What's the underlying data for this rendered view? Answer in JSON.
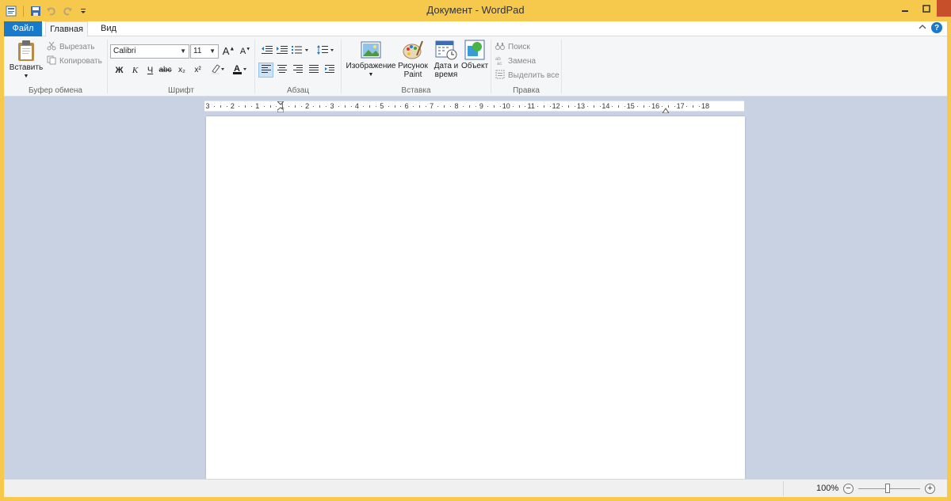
{
  "window": {
    "title": "Документ - WordPad"
  },
  "tabs": {
    "file": "Файл",
    "home": "Главная",
    "view": "Вид"
  },
  "ribbon": {
    "clipboard": {
      "label": "Буфер обмена",
      "paste": "Вставить",
      "cut": "Вырезать",
      "copy": "Копировать"
    },
    "font": {
      "label": "Шрифт",
      "family": "Calibri",
      "size": "11",
      "bold": "Ж",
      "italic": "К",
      "underline": "Ч",
      "strike": "abc",
      "subscript": "x₂",
      "superscript": "x²"
    },
    "paragraph": {
      "label": "Абзац"
    },
    "insert": {
      "label": "Вставка",
      "picture": "Изображение",
      "paint_line1": "Рисунок",
      "paint_line2": "Paint",
      "datetime_line1": "Дата и",
      "datetime_line2": "время",
      "object": "Объект"
    },
    "editing": {
      "label": "Правка",
      "find": "Поиск",
      "replace": "Замена",
      "select_all": "Выделить все"
    }
  },
  "ruler": {
    "ticks": [
      "3",
      "2",
      "1",
      "1",
      "2",
      "3",
      "4",
      "5",
      "6",
      "7",
      "8",
      "9",
      "10",
      "11",
      "12",
      "13",
      "14",
      "15",
      "16",
      "17",
      "18"
    ]
  },
  "status": {
    "zoom": "100%"
  },
  "colors": {
    "frame": "#f6c94c",
    "file_tab": "#1979ca",
    "workspace": "#c8d2e2"
  }
}
